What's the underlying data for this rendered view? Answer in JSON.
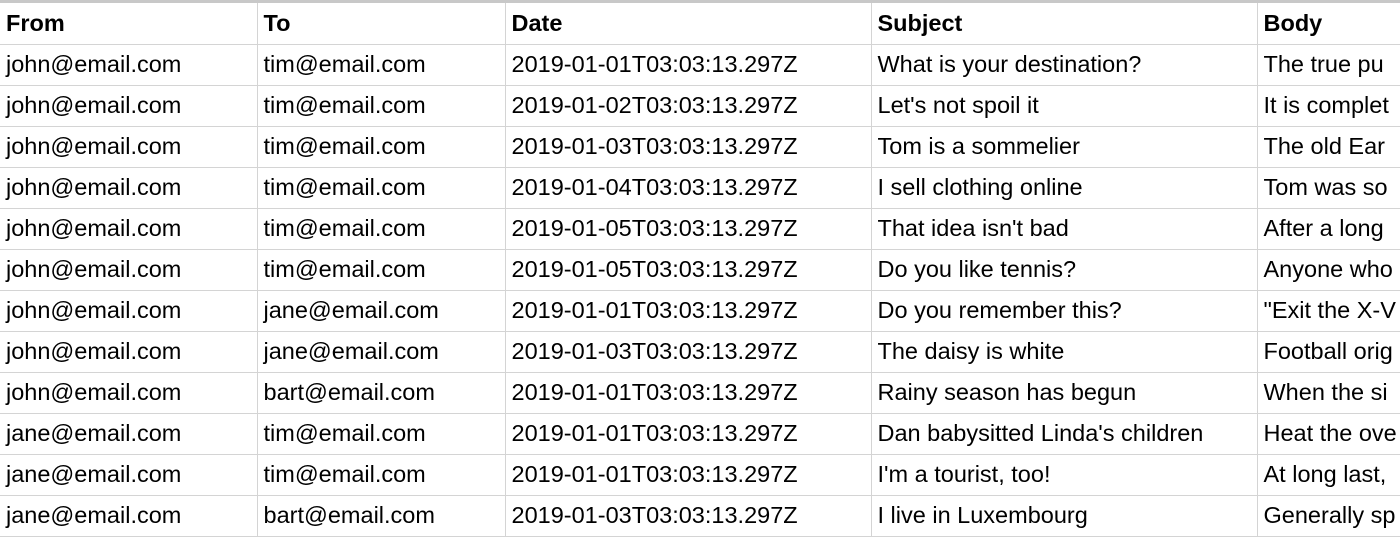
{
  "columns": {
    "from": "From",
    "to": "To",
    "date": "Date",
    "subject": "Subject",
    "body": "Body"
  },
  "rows": [
    {
      "from": "john@email.com",
      "to": "tim@email.com",
      "date": "2019-01-01T03:03:13.297Z",
      "subject": "What is your destination?",
      "body": "The true pu"
    },
    {
      "from": "john@email.com",
      "to": "tim@email.com",
      "date": "2019-01-02T03:03:13.297Z",
      "subject": "Let's not spoil it",
      "body": "It is complet"
    },
    {
      "from": "john@email.com",
      "to": "tim@email.com",
      "date": "2019-01-03T03:03:13.297Z",
      "subject": "Tom is a sommelier",
      "body": "The old Ear"
    },
    {
      "from": "john@email.com",
      "to": "tim@email.com",
      "date": "2019-01-04T03:03:13.297Z",
      "subject": "I sell clothing online",
      "body": "Tom was so"
    },
    {
      "from": "john@email.com",
      "to": "tim@email.com",
      "date": "2019-01-05T03:03:13.297Z",
      "subject": "That idea isn't bad",
      "body": "After a long"
    },
    {
      "from": "john@email.com",
      "to": "tim@email.com",
      "date": "2019-01-05T03:03:13.297Z",
      "subject": "Do you like tennis?",
      "body": "Anyone who"
    },
    {
      "from": "john@email.com",
      "to": "jane@email.com",
      "date": "2019-01-01T03:03:13.297Z",
      "subject": "Do you remember this?",
      "body": "\"Exit the X-V"
    },
    {
      "from": "john@email.com",
      "to": "jane@email.com",
      "date": "2019-01-03T03:03:13.297Z",
      "subject": "The daisy is white",
      "body": "Football orig"
    },
    {
      "from": "john@email.com",
      "to": "bart@email.com",
      "date": "2019-01-01T03:03:13.297Z",
      "subject": "Rainy season has begun",
      "body": "When the si"
    },
    {
      "from": "jane@email.com",
      "to": "tim@email.com",
      "date": "2019-01-01T03:03:13.297Z",
      "subject": "Dan babysitted Linda's children",
      "body": "Heat the ove"
    },
    {
      "from": "jane@email.com",
      "to": "tim@email.com",
      "date": "2019-01-01T03:03:13.297Z",
      "subject": "I'm a tourist, too!",
      "body": "At long last,"
    },
    {
      "from": "jane@email.com",
      "to": "bart@email.com",
      "date": "2019-01-03T03:03:13.297Z",
      "subject": "I live in Luxembourg",
      "body": "Generally sp"
    }
  ]
}
